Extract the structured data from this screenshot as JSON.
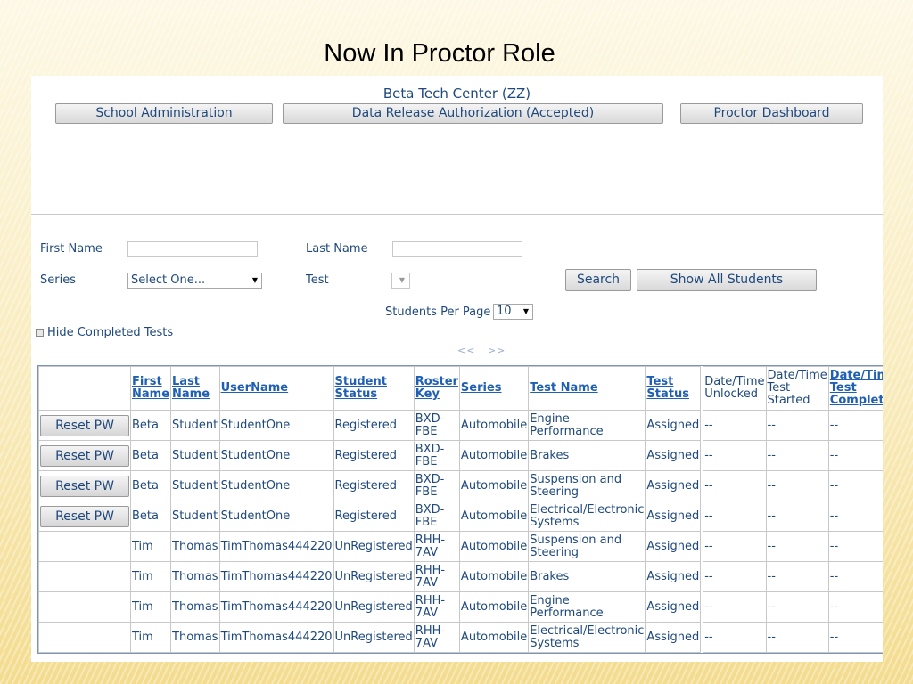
{
  "slide": {
    "title": "Now In Proctor Role"
  },
  "header": {
    "center_name": "Beta Tech Center (ZZ)",
    "nav": {
      "school_admin": "School Administration",
      "data_release": "Data Release Authorization (Accepted)",
      "proctor_dashboard": "Proctor Dashboard"
    }
  },
  "search": {
    "first_name_label": "First Name",
    "first_name_value": "",
    "last_name_label": "Last Name",
    "last_name_value": "",
    "series_label": "Series",
    "series_selected": "Select One...",
    "test_label": "Test",
    "test_selected": "",
    "search_button": "Search",
    "show_all_button": "Show All Students",
    "per_page_label": "Students Per Page",
    "per_page_selected": "10",
    "hide_completed_label": "Hide Completed Tests",
    "pager_prev": "<<",
    "pager_next": ">>"
  },
  "table": {
    "columns": {
      "first_name": "First Name",
      "last_name": "Last Name",
      "username": "UserName",
      "student_status": "Student Status",
      "roster_key": "Roster Key",
      "series": "Series",
      "test_name": "Test Name",
      "test_status": "Test Status",
      "unlocked": "Date/Time Unlocked",
      "started": "Date/Time Test Started",
      "completed": "Date/Time Test Completed"
    },
    "reset_label": "Reset PW",
    "rows": [
      {
        "reset": true,
        "first": "Beta",
        "last": "Student",
        "user": "StudentOne",
        "status": "Registered",
        "roster": "BXD-FBE",
        "series": "Automobile",
        "test": "Engine Performance",
        "test_status": "Assigned",
        "unlocked": "--",
        "started": "--",
        "completed": "--"
      },
      {
        "reset": true,
        "first": "Beta",
        "last": "Student",
        "user": "StudentOne",
        "status": "Registered",
        "roster": "BXD-FBE",
        "series": "Automobile",
        "test": "Brakes",
        "test_status": "Assigned",
        "unlocked": "--",
        "started": "--",
        "completed": "--"
      },
      {
        "reset": true,
        "first": "Beta",
        "last": "Student",
        "user": "StudentOne",
        "status": "Registered",
        "roster": "BXD-FBE",
        "series": "Automobile",
        "test": "Suspension and Steering",
        "test_status": "Assigned",
        "unlocked": "--",
        "started": "--",
        "completed": "--"
      },
      {
        "reset": true,
        "first": "Beta",
        "last": "Student",
        "user": "StudentOne",
        "status": "Registered",
        "roster": "BXD-FBE",
        "series": "Automobile",
        "test": "Electrical/Electronic Systems",
        "test_status": "Assigned",
        "unlocked": "--",
        "started": "--",
        "completed": "--"
      },
      {
        "reset": false,
        "first": "Tim",
        "last": "Thomas",
        "user": "TimThomas444220",
        "status": "UnRegistered",
        "roster": "RHH-7AV",
        "series": "Automobile",
        "test": "Suspension and Steering",
        "test_status": "Assigned",
        "unlocked": "--",
        "started": "--",
        "completed": "--"
      },
      {
        "reset": false,
        "first": "Tim",
        "last": "Thomas",
        "user": "TimThomas444220",
        "status": "UnRegistered",
        "roster": "RHH-7AV",
        "series": "Automobile",
        "test": "Brakes",
        "test_status": "Assigned",
        "unlocked": "--",
        "started": "--",
        "completed": "--"
      },
      {
        "reset": false,
        "first": "Tim",
        "last": "Thomas",
        "user": "TimThomas444220",
        "status": "UnRegistered",
        "roster": "RHH-7AV",
        "series": "Automobile",
        "test": "Engine Performance",
        "test_status": "Assigned",
        "unlocked": "--",
        "started": "--",
        "completed": "--"
      },
      {
        "reset": false,
        "first": "Tim",
        "last": "Thomas",
        "user": "TimThomas444220",
        "status": "UnRegistered",
        "roster": "RHH-7AV",
        "series": "Automobile",
        "test": "Electrical/Electronic Systems",
        "test_status": "Assigned",
        "unlocked": "--",
        "started": "--",
        "completed": "--"
      }
    ]
  }
}
